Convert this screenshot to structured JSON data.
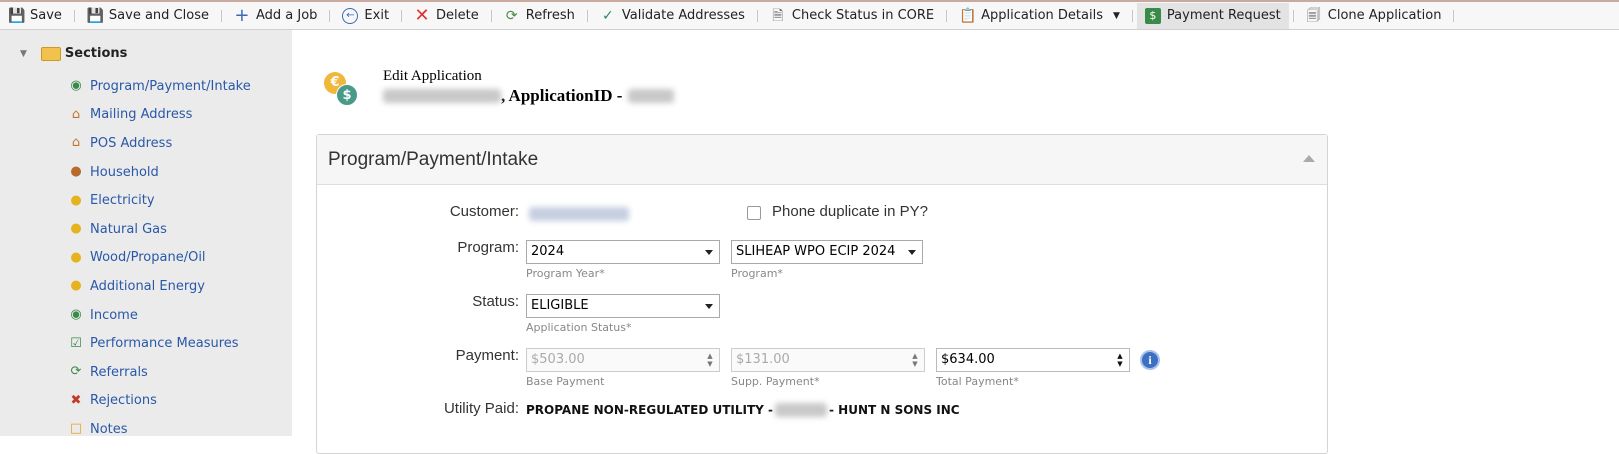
{
  "toolbar": {
    "items": [
      {
        "label": "Save",
        "icon": "floppy-icon"
      },
      {
        "label": "Save and Close",
        "icon": "floppy-close-icon"
      },
      {
        "label": "Add a Job",
        "icon": "plus-icon"
      },
      {
        "label": "Exit",
        "icon": "exit-icon"
      },
      {
        "label": "Delete",
        "icon": "delete-x-icon"
      },
      {
        "label": "Refresh",
        "icon": "refresh-icon"
      },
      {
        "label": "Validate Addresses",
        "icon": "check-icon"
      },
      {
        "label": "Check Status in CORE",
        "icon": "document-icon"
      },
      {
        "label": "Application Details",
        "icon": "clipboard-icon"
      },
      {
        "label": "Payment Request",
        "icon": "dollar-doc-icon"
      },
      {
        "label": "Clone Application",
        "icon": "copy-icon"
      }
    ]
  },
  "sidebar": {
    "title": "Sections",
    "items": [
      {
        "label": "Program/Payment/Intake",
        "icon": "coins-icon"
      },
      {
        "label": "Mailing Address",
        "icon": "house-icon"
      },
      {
        "label": "POS Address",
        "icon": "house-icon"
      },
      {
        "label": "Household",
        "icon": "people-icon"
      },
      {
        "label": "Electricity",
        "icon": "bulb-icon"
      },
      {
        "label": "Natural Gas",
        "icon": "bulb-icon"
      },
      {
        "label": "Wood/Propane/Oil",
        "icon": "bulb-icon"
      },
      {
        "label": "Additional Energy",
        "icon": "bulb-icon"
      },
      {
        "label": "Income",
        "icon": "coins-icon"
      },
      {
        "label": "Performance Measures",
        "icon": "checklist-icon"
      },
      {
        "label": "Referrals",
        "icon": "referral-icon"
      },
      {
        "label": "Rejections",
        "icon": "rejection-icon"
      },
      {
        "label": "Notes",
        "icon": "note-icon"
      }
    ]
  },
  "header": {
    "title": "Edit Application",
    "subtitle_mid": ", ApplicationID -"
  },
  "panel": {
    "title": "Program/Payment/Intake",
    "customer_label": "Customer:",
    "phone_dup_label": "Phone duplicate in PY?",
    "program_label": "Program:",
    "program_year": "2024",
    "program_year_hint": "Program Year*",
    "program": "SLIHEAP WPO ECIP 2024",
    "program_hint": "Program*",
    "status_label": "Status:",
    "status": "ELIGIBLE",
    "status_hint": "Application Status*",
    "payment_label": "Payment:",
    "base_payment": "$503.00",
    "base_payment_hint": "Base Payment",
    "supp_payment": "$131.00",
    "supp_payment_hint": "Supp. Payment*",
    "total_payment": "$634.00",
    "total_payment_hint": "Total Payment*",
    "utility_label": "Utility Paid:",
    "utility_prefix": "PROPANE NON-REGULATED UTILITY -",
    "utility_suffix": "- HUNT N SONS INC"
  },
  "colors": {
    "link": "#2a58a8",
    "sidebar_bg": "#ebebeb",
    "info_blue": "#3d6fc4"
  }
}
